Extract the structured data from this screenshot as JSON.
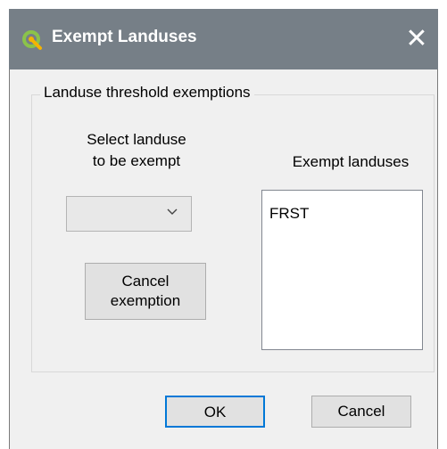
{
  "window": {
    "title": "Exempt Landuses",
    "close_glyph": "✕",
    "app_icon": "qgis-icon"
  },
  "group": {
    "title": "Landuse threshold exemptions"
  },
  "select_label": {
    "line1": "Select landuse",
    "line2": "to be exempt"
  },
  "exempt_label": "Exempt landuses",
  "combo": {
    "value": "",
    "icon": "chevron-down-icon"
  },
  "exempt_list": {
    "items": [
      "FRST"
    ]
  },
  "buttons": {
    "cancel_exemption_line1": "Cancel",
    "cancel_exemption_line2": "exemption",
    "ok": "OK",
    "cancel": "Cancel"
  },
  "colors": {
    "titlebar": "#767f87",
    "dialog_bg": "#f0f0f0",
    "focus_border": "#0078d7"
  }
}
